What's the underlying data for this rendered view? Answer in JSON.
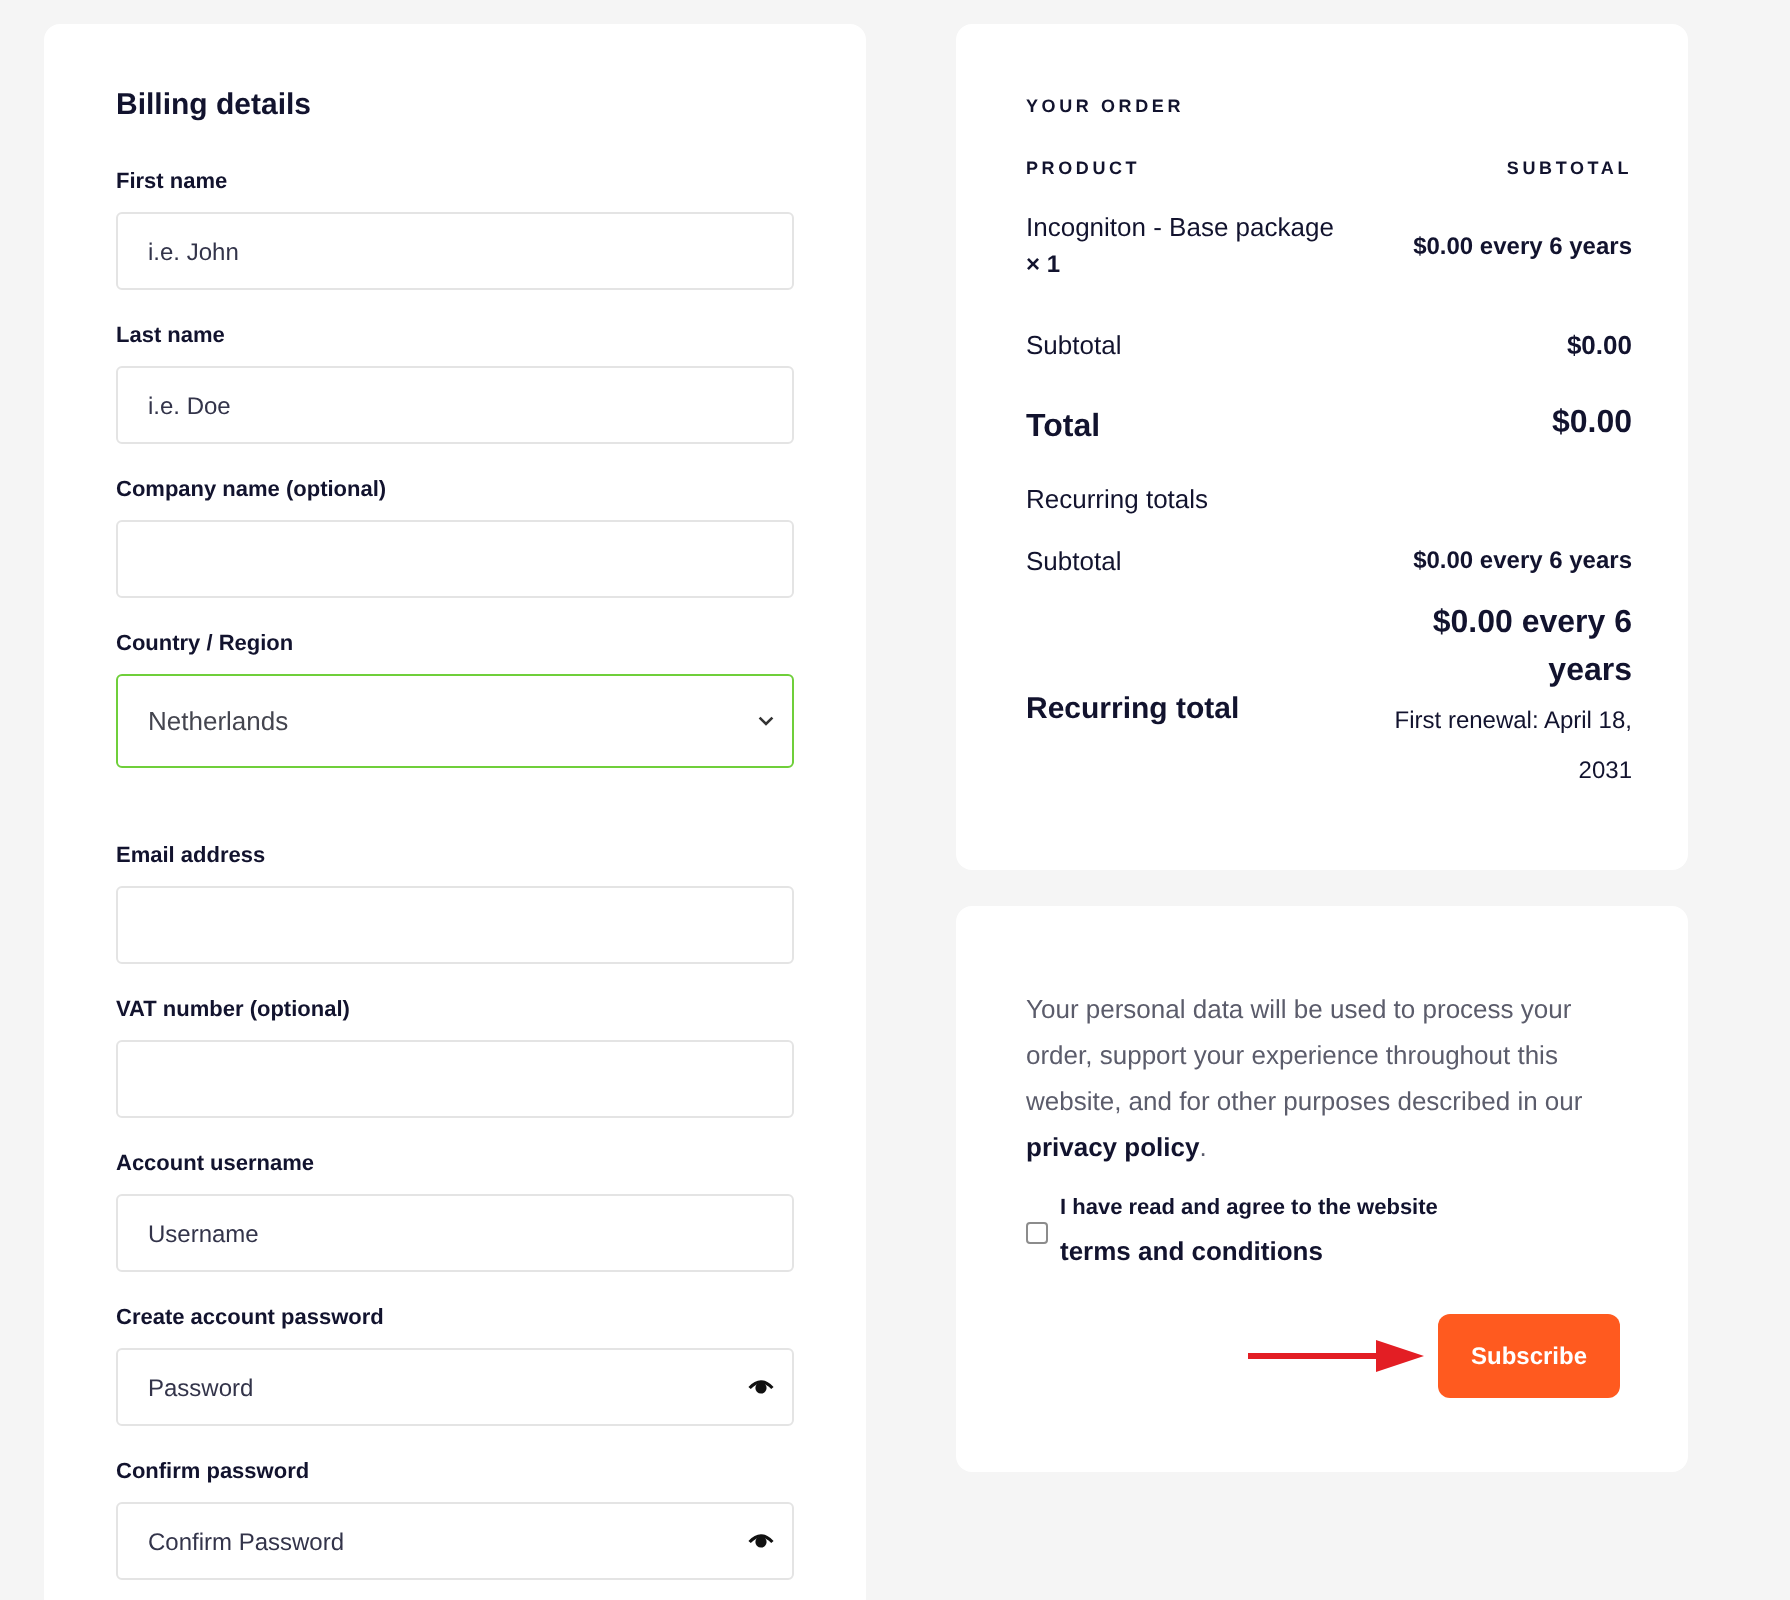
{
  "billing": {
    "title": "Billing details",
    "fields": [
      {
        "kind": "text",
        "label": "First name",
        "placeholder": "i.e. John"
      },
      {
        "kind": "text",
        "label": "Last name",
        "placeholder": "i.e. Doe"
      },
      {
        "kind": "text",
        "label": "Company name (optional)"
      },
      {
        "kind": "select",
        "label": "Country / Region",
        "value": "Netherlands",
        "valid": true
      },
      {
        "kind": "text",
        "label": "Email address"
      },
      {
        "kind": "text",
        "label": "VAT number (optional)"
      },
      {
        "kind": "text",
        "label": "Account username",
        "placeholder": "Username"
      },
      {
        "kind": "password",
        "label": "Create account password",
        "placeholder": "Password"
      },
      {
        "kind": "password",
        "label": "Confirm password",
        "placeholder": "Confirm Password"
      }
    ]
  },
  "order": {
    "title": "YOUR ORDER",
    "columns": [
      "PRODUCT",
      "SUBTOTAL"
    ],
    "items": [
      {
        "name": "Incogniton - Base package",
        "quantity": "× 1",
        "price": "$0.00 every 6 years"
      }
    ],
    "subtotal": {
      "label": "Subtotal",
      "value": "$0.00"
    },
    "total": {
      "label": "Total",
      "value": "$0.00"
    },
    "recurring": {
      "title": "Recurring totals",
      "subtotal": {
        "label": "Subtotal",
        "value": "$0.00 every 6 years"
      },
      "total": {
        "label": "Recurring total",
        "value": "$0.00 every 6 years",
        "renewal": "First renewal: April 18, 2031"
      }
    }
  },
  "checkout": {
    "privacy": {
      "text": "Your personal data will be used to process your order, support your experience throughout this website, and for other purposes described in our",
      "link": "privacy policy",
      "end": "."
    },
    "terms": {
      "checked": false,
      "text": "I have read and agree to the website",
      "link": "terms and conditions"
    },
    "button": "Subscribe"
  }
}
